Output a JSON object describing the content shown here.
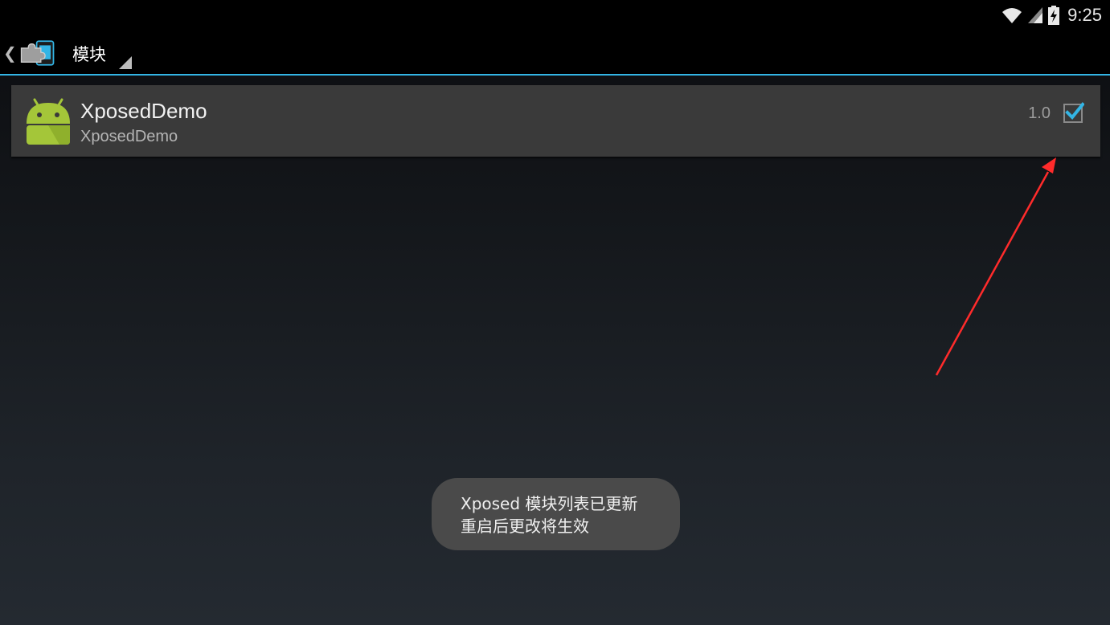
{
  "status_bar": {
    "time": "9:25",
    "icons": [
      "wifi-icon",
      "cell-signal-icon",
      "battery-charging-icon"
    ]
  },
  "action_bar": {
    "app_icon": "xposed-puzzle-icon",
    "title": "模块"
  },
  "modules": [
    {
      "name": "XposedDemo",
      "description": "XposedDemo",
      "version": "1.0",
      "enabled": true,
      "icon": "android-robot-icon"
    }
  ],
  "toast": {
    "line1": "Xposed 模块列表已更新",
    "line2": "重启后更改将生效"
  },
  "colors": {
    "accent": "#33b5e5",
    "annotation_arrow": "#ff2b2b",
    "android_green": "#a4c639"
  }
}
